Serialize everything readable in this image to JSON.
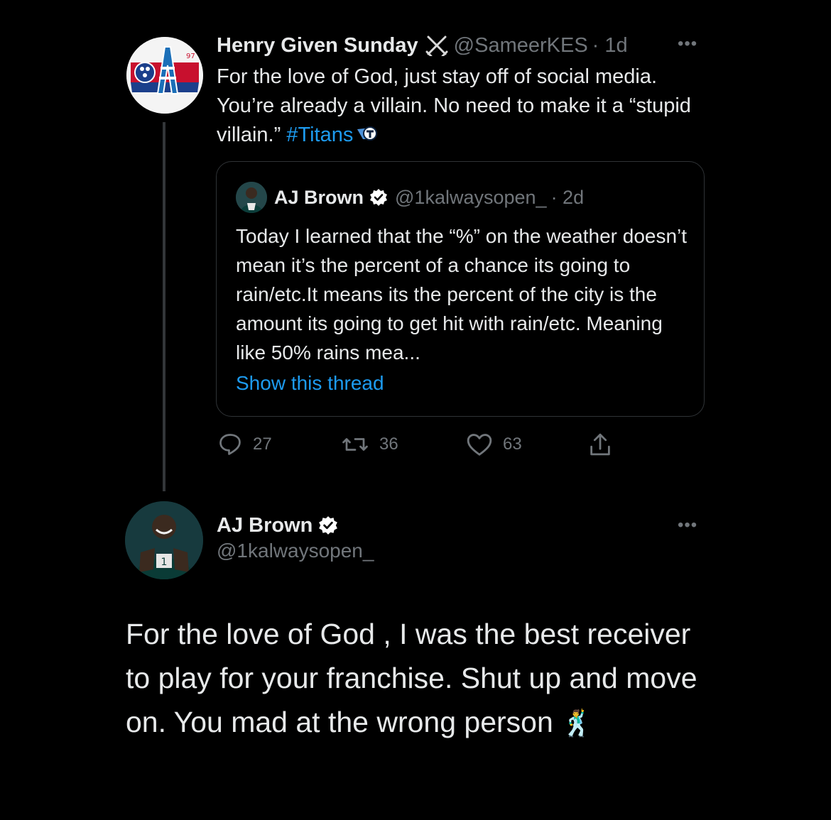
{
  "parent_tweet": {
    "display_name": "Henry Given Sunday",
    "handle": "@SameerKES",
    "time": "· 1d",
    "text_before_tag": "For the love of God, just stay off of social media. You’re already a villain. No need to make it a “stupid villain.” ",
    "hashtag": "#Titans",
    "avatar_badge": "97",
    "more": "•••"
  },
  "quoted_tweet": {
    "display_name": "AJ Brown",
    "handle": "@1kalwaysopen_",
    "time": "· 2d",
    "text": "Today I learned that the “%” on the weather doesn’t mean it’s the percent of a chance its going to rain/etc.It means its the percent of the city is the amount its going to get hit with rain/etc. Meaning like 50% rains mea...",
    "show_thread": "Show this thread"
  },
  "actions": {
    "replies": "27",
    "retweets": "36",
    "likes": "63"
  },
  "main_tweet": {
    "display_name": "AJ Brown",
    "handle": "@1kalwaysopen_",
    "text": "For the love of God , I was the best receiver to play for your franchise. Shut up and move on. You mad at the wrong person ",
    "emoji": "🕺",
    "more": "•••"
  },
  "colors": {
    "background": "#000000",
    "text": "#e7e9ea",
    "secondary": "#71767b",
    "link": "#1d9bf0",
    "verified_badge": "#ffffff",
    "border": "#2f3336"
  }
}
